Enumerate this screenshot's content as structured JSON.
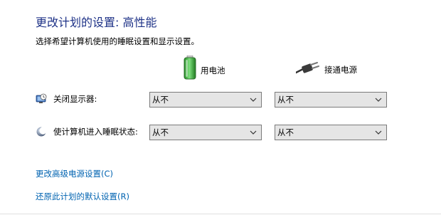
{
  "header": {
    "title": "更改计划的设置: 高性能",
    "subtitle": "选择希望计算机使用的睡眠设置和显示设置。"
  },
  "columns": {
    "battery_label": "用电池",
    "battery_icon": "battery-icon",
    "plugged_label": "接通电源",
    "plugged_icon": "power-plug-icon"
  },
  "settings": [
    {
      "label": "关闭显示器:",
      "icon": "monitor-clock-icon",
      "battery_value": "从不",
      "plugged_value": "从不"
    },
    {
      "label": "使计算机进入睡眠状态:",
      "icon": "moon-sleep-icon",
      "battery_value": "从不",
      "plugged_value": "从不"
    }
  ],
  "links": {
    "advanced": "更改高级电源设置(C)",
    "restore": "还原此计划的默认设置(R)"
  },
  "colors": {
    "title": "#1e3287",
    "link": "#0063b1",
    "select_bg": "#e5e5e5",
    "select_border": "#7a7a7a"
  }
}
